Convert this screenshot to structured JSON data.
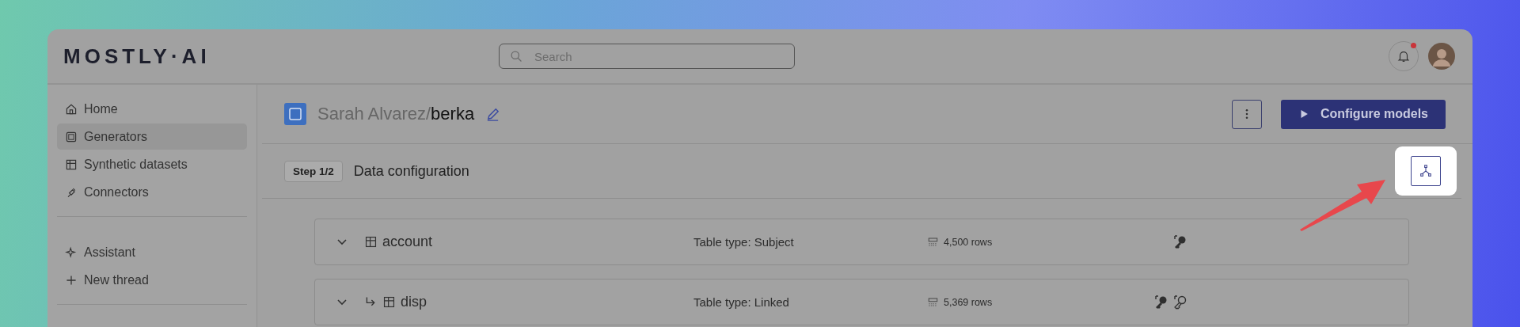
{
  "header": {
    "logo": "MOSTLY·AI",
    "search": {
      "placeholder": "Search"
    },
    "notifications": {
      "unread": true
    }
  },
  "sidebar": {
    "sections": [
      {
        "items": [
          {
            "label": "Home",
            "kind": "home",
            "selected": false
          },
          {
            "label": "Generators",
            "kind": "generator",
            "selected": true
          },
          {
            "label": "Synthetic datasets",
            "kind": "dataset",
            "selected": false
          },
          {
            "label": "Connectors",
            "kind": "connector",
            "selected": false
          }
        ]
      },
      {
        "items": [
          {
            "label": "Assistant",
            "kind": "assistant",
            "selected": false
          },
          {
            "label": "New thread",
            "kind": "new",
            "selected": false
          }
        ]
      }
    ]
  },
  "generator": {
    "owner": "Sarah Alvarez/",
    "name": "berka",
    "primary_button": "Configure models"
  },
  "step": {
    "badge": "Step 1/2",
    "title": "Data configuration"
  },
  "diagram_button": {
    "highlighted": true
  },
  "tables": [
    {
      "name": "account",
      "linked": false,
      "expanded": false,
      "table_type": "Table type: Subject",
      "rows": "4,500 rows",
      "keys": [
        {
          "kind": "primary"
        }
      ]
    },
    {
      "name": "disp",
      "linked": true,
      "expanded": false,
      "table_type": "Table type: Linked",
      "rows": "5,369 rows",
      "keys": [
        {
          "kind": "primary"
        },
        {
          "kind": "foreign"
        }
      ]
    }
  ]
}
